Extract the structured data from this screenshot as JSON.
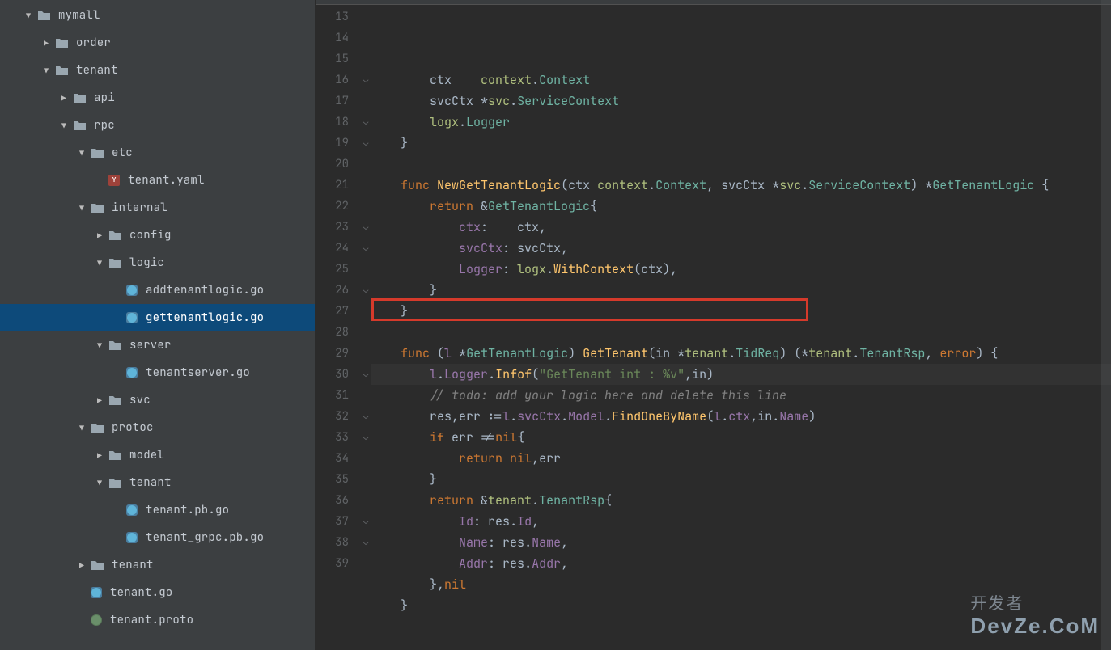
{
  "tree": [
    {
      "depth": 0,
      "arrow": "down",
      "icon": "folder",
      "label": "mymall"
    },
    {
      "depth": 1,
      "arrow": "right",
      "icon": "folder",
      "label": "order"
    },
    {
      "depth": 1,
      "arrow": "down",
      "icon": "folder",
      "label": "tenant"
    },
    {
      "depth": 2,
      "arrow": "right",
      "icon": "folder",
      "label": "api"
    },
    {
      "depth": 2,
      "arrow": "down",
      "icon": "folder",
      "label": "rpc"
    },
    {
      "depth": 3,
      "arrow": "down",
      "icon": "folder",
      "label": "etc"
    },
    {
      "depth": 4,
      "arrow": "blank",
      "icon": "yamlfile",
      "label": "tenant.yaml"
    },
    {
      "depth": 3,
      "arrow": "down",
      "icon": "folder",
      "label": "internal"
    },
    {
      "depth": 4,
      "arrow": "right",
      "icon": "folder",
      "label": "config"
    },
    {
      "depth": 4,
      "arrow": "down",
      "icon": "folder",
      "label": "logic"
    },
    {
      "depth": 5,
      "arrow": "blank",
      "icon": "gofile",
      "label": "addtenantlogic.go"
    },
    {
      "depth": 5,
      "arrow": "blank",
      "icon": "gofile",
      "label": "gettenantlogic.go",
      "selected": true
    },
    {
      "depth": 4,
      "arrow": "down",
      "icon": "folder",
      "label": "server"
    },
    {
      "depth": 5,
      "arrow": "blank",
      "icon": "gofile",
      "label": "tenantserver.go"
    },
    {
      "depth": 4,
      "arrow": "right",
      "icon": "folder",
      "label": "svc"
    },
    {
      "depth": 3,
      "arrow": "down",
      "icon": "folder",
      "label": "protoc"
    },
    {
      "depth": 4,
      "arrow": "right",
      "icon": "folder",
      "label": "model"
    },
    {
      "depth": 4,
      "arrow": "down",
      "icon": "folder",
      "label": "tenant"
    },
    {
      "depth": 5,
      "arrow": "blank",
      "icon": "gofile",
      "label": "tenant.pb.go"
    },
    {
      "depth": 5,
      "arrow": "blank",
      "icon": "gofile",
      "label": "tenant_grpc.pb.go"
    },
    {
      "depth": 3,
      "arrow": "right",
      "icon": "folder",
      "label": "tenant"
    },
    {
      "depth": 3,
      "arrow": "blank",
      "icon": "gofile",
      "label": "tenant.go"
    },
    {
      "depth": 3,
      "arrow": "blank",
      "icon": "protofile",
      "label": "tenant.proto"
    }
  ],
  "code": {
    "first_line_no": 13,
    "highlight_line_no": 27,
    "redbox_line_no": 27,
    "lines": [
      {
        "n": 13,
        "fold": "",
        "tokens": [
          [
            "pnc",
            "        "
          ],
          [
            "id",
            "ctx"
          ],
          [
            "pnc",
            "    "
          ],
          [
            "pkg",
            "context"
          ],
          [
            "pnc",
            "."
          ],
          [
            "ty-teal",
            "Context"
          ]
        ]
      },
      {
        "n": 14,
        "fold": "",
        "tokens": [
          [
            "pnc",
            "        "
          ],
          [
            "id",
            "svcCtx"
          ],
          [
            "pnc",
            " "
          ],
          [
            "op",
            "*"
          ],
          [
            "pkg",
            "svc"
          ],
          [
            "pnc",
            "."
          ],
          [
            "ty-teal",
            "ServiceContext"
          ]
        ]
      },
      {
        "n": 15,
        "fold": "",
        "tokens": [
          [
            "pnc",
            "        "
          ],
          [
            "pkg",
            "logx"
          ],
          [
            "pnc",
            "."
          ],
          [
            "ty-teal",
            "Logger"
          ]
        ]
      },
      {
        "n": 16,
        "fold": "⌄",
        "tokens": [
          [
            "pnc",
            "    }"
          ]
        ]
      },
      {
        "n": 17,
        "fold": "",
        "tokens": [
          [
            "pnc",
            ""
          ]
        ]
      },
      {
        "n": 18,
        "fold": "⌄",
        "tokens": [
          [
            "pnc",
            "    "
          ],
          [
            "kw",
            "func"
          ],
          [
            "pnc",
            " "
          ],
          [
            "fn",
            "NewGetTenantLogic"
          ],
          [
            "pnc",
            "("
          ],
          [
            "id",
            "ctx"
          ],
          [
            "pnc",
            " "
          ],
          [
            "pkg",
            "context"
          ],
          [
            "pnc",
            "."
          ],
          [
            "ty-teal",
            "Context"
          ],
          [
            "pnc",
            ", "
          ],
          [
            "id",
            "svcCtx"
          ],
          [
            "pnc",
            " "
          ],
          [
            "op",
            "*"
          ],
          [
            "pkg",
            "svc"
          ],
          [
            "pnc",
            "."
          ],
          [
            "ty-teal",
            "ServiceContext"
          ],
          [
            "pnc",
            ") "
          ],
          [
            "op",
            "*"
          ],
          [
            "ty-teal",
            "GetTenantLogic"
          ],
          [
            "pnc",
            " {"
          ]
        ]
      },
      {
        "n": 19,
        "fold": "⌄",
        "tokens": [
          [
            "pnc",
            "        "
          ],
          [
            "kw",
            "return"
          ],
          [
            "pnc",
            " &"
          ],
          [
            "ty-teal",
            "GetTenantLogic"
          ],
          [
            "pnc",
            "{"
          ]
        ]
      },
      {
        "n": 20,
        "fold": "",
        "tokens": [
          [
            "pnc",
            "            "
          ],
          [
            "field",
            "ctx"
          ],
          [
            "pnc",
            ":    "
          ],
          [
            "id",
            "ctx"
          ],
          [
            "pnc",
            ","
          ]
        ]
      },
      {
        "n": 21,
        "fold": "",
        "tokens": [
          [
            "pnc",
            "            "
          ],
          [
            "field",
            "svcCtx"
          ],
          [
            "pnc",
            ": "
          ],
          [
            "id",
            "svcCtx"
          ],
          [
            "pnc",
            ","
          ]
        ]
      },
      {
        "n": 22,
        "fold": "",
        "tokens": [
          [
            "pnc",
            "            "
          ],
          [
            "field",
            "Logger"
          ],
          [
            "pnc",
            ": "
          ],
          [
            "pkg",
            "logx"
          ],
          [
            "pnc",
            "."
          ],
          [
            "fn-b",
            "WithContext"
          ],
          [
            "pnc",
            "("
          ],
          [
            "id",
            "ctx"
          ],
          [
            "pnc",
            "),"
          ]
        ]
      },
      {
        "n": 23,
        "fold": "⌄",
        "tokens": [
          [
            "pnc",
            "        }"
          ]
        ]
      },
      {
        "n": 24,
        "fold": "⌄",
        "tokens": [
          [
            "pnc",
            "    }"
          ]
        ]
      },
      {
        "n": 25,
        "fold": "",
        "tokens": [
          [
            "pnc",
            ""
          ]
        ]
      },
      {
        "n": 26,
        "fold": "⌄",
        "tokens": [
          [
            "pnc",
            "    "
          ],
          [
            "kw",
            "func"
          ],
          [
            "pnc",
            " ("
          ],
          [
            "id-lilac",
            "l"
          ],
          [
            "pnc",
            " "
          ],
          [
            "op",
            "*"
          ],
          [
            "ty-teal",
            "GetTenantLogic"
          ],
          [
            "pnc",
            ") "
          ],
          [
            "fn",
            "GetTenant"
          ],
          [
            "pnc",
            "("
          ],
          [
            "id",
            "in"
          ],
          [
            "pnc",
            " "
          ],
          [
            "op",
            "*"
          ],
          [
            "pkg",
            "tenant"
          ],
          [
            "pnc",
            "."
          ],
          [
            "ty-teal",
            "TidReq"
          ],
          [
            "pnc",
            ") ("
          ],
          [
            "op",
            "*"
          ],
          [
            "pkg",
            "tenant"
          ],
          [
            "pnc",
            "."
          ],
          [
            "ty-teal",
            "TenantRsp"
          ],
          [
            "pnc",
            ", "
          ],
          [
            "kw",
            "error"
          ],
          [
            "pnc",
            ") {"
          ]
        ]
      },
      {
        "n": 27,
        "fold": "",
        "tokens": [
          [
            "pnc",
            "        "
          ],
          [
            "id-lilac",
            "l"
          ],
          [
            "pnc",
            "."
          ],
          [
            "field",
            "Logger"
          ],
          [
            "pnc",
            "."
          ],
          [
            "fn-b",
            "Infof"
          ],
          [
            "pnc",
            "("
          ],
          [
            "str",
            "\"GetTenant int : %v\""
          ],
          [
            "pnc",
            ","
          ],
          [
            "id",
            "in"
          ],
          [
            "pnc",
            ")"
          ]
        ]
      },
      {
        "n": 28,
        "fold": "",
        "tokens": [
          [
            "pnc",
            "        "
          ],
          [
            "cmt",
            "// todo: add your logic here and delete this line"
          ]
        ]
      },
      {
        "n": 29,
        "fold": "",
        "tokens": [
          [
            "pnc",
            "        "
          ],
          [
            "id",
            "res"
          ],
          [
            "pnc",
            ","
          ],
          [
            "id",
            "err"
          ],
          [
            "pnc",
            " :="
          ],
          [
            "id-lilac",
            "l"
          ],
          [
            "pnc",
            "."
          ],
          [
            "field",
            "svcCtx"
          ],
          [
            "pnc",
            "."
          ],
          [
            "field",
            "Model"
          ],
          [
            "pnc",
            "."
          ],
          [
            "fn-b",
            "FindOneByName"
          ],
          [
            "pnc",
            "("
          ],
          [
            "id-lilac",
            "l"
          ],
          [
            "pnc",
            "."
          ],
          [
            "field",
            "ctx"
          ],
          [
            "pnc",
            ","
          ],
          [
            "id",
            "in"
          ],
          [
            "pnc",
            "."
          ],
          [
            "field",
            "Name"
          ],
          [
            "pnc",
            ")"
          ]
        ]
      },
      {
        "n": 30,
        "fold": "⌄",
        "tokens": [
          [
            "pnc",
            "        "
          ],
          [
            "kw",
            "if"
          ],
          [
            "pnc",
            " "
          ],
          [
            "id",
            "err"
          ],
          [
            "pnc",
            " !="
          ],
          [
            "kw",
            "nil"
          ],
          [
            "pnc",
            "{"
          ]
        ]
      },
      {
        "n": 31,
        "fold": "",
        "tokens": [
          [
            "pnc",
            "            "
          ],
          [
            "kw",
            "return"
          ],
          [
            "pnc",
            " "
          ],
          [
            "kw",
            "nil"
          ],
          [
            "pnc",
            ","
          ],
          [
            "id",
            "err"
          ]
        ]
      },
      {
        "n": 32,
        "fold": "⌄",
        "tokens": [
          [
            "pnc",
            "        }"
          ]
        ]
      },
      {
        "n": 33,
        "fold": "⌄",
        "tokens": [
          [
            "pnc",
            "        "
          ],
          [
            "kw",
            "return"
          ],
          [
            "pnc",
            " &"
          ],
          [
            "pkg",
            "tenant"
          ],
          [
            "pnc",
            "."
          ],
          [
            "ty-teal",
            "TenantRsp"
          ],
          [
            "pnc",
            "{"
          ]
        ]
      },
      {
        "n": 34,
        "fold": "",
        "tokens": [
          [
            "pnc",
            "            "
          ],
          [
            "field",
            "Id"
          ],
          [
            "pnc",
            ": "
          ],
          [
            "id",
            "res"
          ],
          [
            "pnc",
            "."
          ],
          [
            "field",
            "Id"
          ],
          [
            "pnc",
            ","
          ]
        ]
      },
      {
        "n": 35,
        "fold": "",
        "tokens": [
          [
            "pnc",
            "            "
          ],
          [
            "field",
            "Name"
          ],
          [
            "pnc",
            ": "
          ],
          [
            "id",
            "res"
          ],
          [
            "pnc",
            "."
          ],
          [
            "field",
            "Name"
          ],
          [
            "pnc",
            ","
          ]
        ]
      },
      {
        "n": 36,
        "fold": "",
        "tokens": [
          [
            "pnc",
            "            "
          ],
          [
            "field",
            "Addr"
          ],
          [
            "pnc",
            ": "
          ],
          [
            "id",
            "res"
          ],
          [
            "pnc",
            "."
          ],
          [
            "field",
            "Addr"
          ],
          [
            "pnc",
            ","
          ]
        ]
      },
      {
        "n": 37,
        "fold": "⌄",
        "tokens": [
          [
            "pnc",
            "        },"
          ],
          [
            "kw",
            "nil"
          ]
        ]
      },
      {
        "n": 38,
        "fold": "⌄",
        "tokens": [
          [
            "pnc",
            "    }"
          ]
        ]
      },
      {
        "n": 39,
        "fold": "",
        "tokens": [
          [
            "pnc",
            ""
          ]
        ]
      }
    ]
  },
  "watermark": {
    "small": "开发者",
    "brand": "DevZe.CoM"
  }
}
